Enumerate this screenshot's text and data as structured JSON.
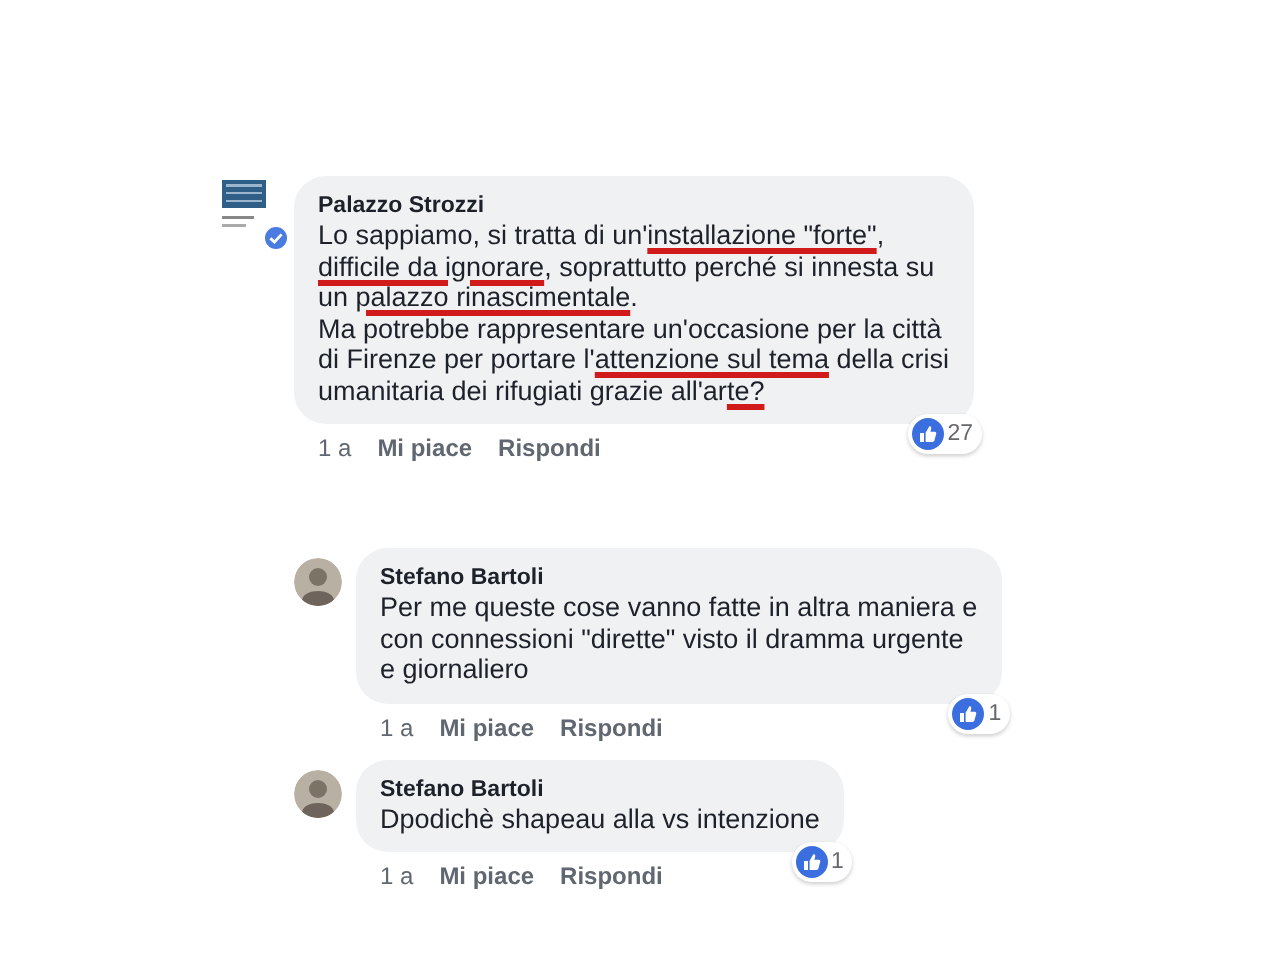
{
  "comments": [
    {
      "kind": "comment",
      "verified": true,
      "author": "Palazzo Strozzi",
      "lines": [
        [
          {
            "text": "Lo sappiamo, si tratta di un'",
            "marked": false
          },
          {
            "text": "installazione \"forte\"",
            "marked": true
          },
          {
            "text": ",",
            "marked": false
          }
        ],
        [
          {
            "text": "difficile da ignorare",
            "marked": true
          },
          {
            "text": ", soprattutto perché si innesta su",
            "marked": false
          }
        ],
        [
          {
            "text": "un ",
            "marked": false
          },
          {
            "text": "palazzo rinascimentale",
            "marked": true
          },
          {
            "text": ".",
            "marked": false
          }
        ],
        [
          {
            "text": "Ma potrebbe rappresentare un'occasione per la città",
            "marked": false
          }
        ],
        [
          {
            "text": "di Firenze per portare l'",
            "marked": false
          },
          {
            "text": "attenzione sul tema",
            "marked": true
          },
          {
            "text": " della crisi",
            "marked": false
          }
        ],
        [
          {
            "text": "umanitaria dei rifugiati grazie all'ar",
            "marked": false
          },
          {
            "text": "te?",
            "marked": true
          }
        ]
      ],
      "time": "1 a",
      "like": "Mi piace",
      "reply": "Rispondi",
      "reactions": "27"
    },
    {
      "kind": "reply",
      "author": "Stefano Bartoli",
      "lines": [
        [
          {
            "text": "Per me queste cose vanno fatte in altra maniera e",
            "marked": false
          }
        ],
        [
          {
            "text": "con connessioni \"dirette\" visto il dramma urgente",
            "marked": false
          }
        ],
        [
          {
            "text": "e giornaliero",
            "marked": false
          }
        ]
      ],
      "time": "1 a",
      "like": "Mi piace",
      "reply": "Rispondi",
      "reactions": "1"
    },
    {
      "kind": "reply",
      "author": "Stefano Bartoli",
      "lines": [
        [
          {
            "text": "Dpodichè shapeau alla vs intenzione",
            "marked": false
          }
        ]
      ],
      "time": "1 a",
      "like": "Mi piace",
      "reply": "Rispondi",
      "reactions": "1"
    }
  ]
}
